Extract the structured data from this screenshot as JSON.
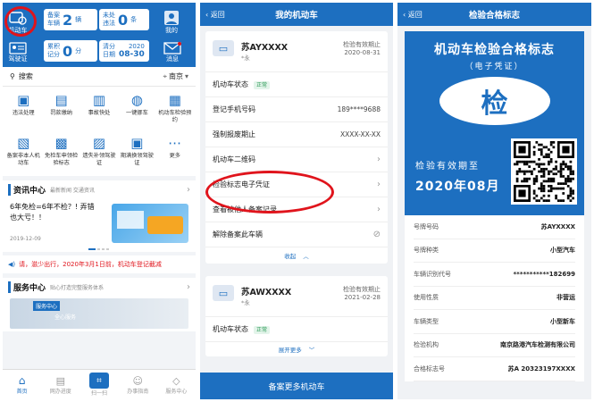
{
  "p1": {
    "tiles": {
      "car": "机动车",
      "license": "驾驶证",
      "mine": "我的",
      "msg": "消息"
    },
    "stats": {
      "pending_l1": "备案",
      "pending_l2": "车辆",
      "pending_n": "2",
      "pending_u": "辆",
      "unhandled_l1": "未处",
      "unhandled_l2": "违法",
      "unhandled_n": "0",
      "unhandled_u": "条",
      "points_l1": "累积",
      "points_l2": "记分",
      "points_n": "0",
      "points_u": "分",
      "clear_l1": "清分",
      "clear_l2": "日期",
      "clear_year": "2020",
      "clear_date": "08-30"
    },
    "search": "搜索",
    "city": "南京",
    "grid": [
      "违法处理",
      "罚款缴纳",
      "事故快处",
      "一键挪车",
      "机动车检验预约",
      "备案非本人机动车",
      "免检车申领检验标志",
      "遗失补领驾驶证",
      "期满换领驾驶证",
      "更多"
    ],
    "news_title": "资讯中心",
    "news_sub": "最新新闻 交通资讯",
    "news_text": "6年免检=6年不检？! 弄错也大亏！！",
    "news_date": "2019-12-09",
    "notice": "请，滋少出行，2020年3月1日前，机动车登记截减",
    "service_title": "服务中心",
    "service_sub": "贴心打造完整服务体系",
    "service_img": "服务中心",
    "service_img2": "全心服务",
    "tabs": [
      "首页",
      "网办进度",
      "扫一扫",
      "办事指南",
      "服务中心"
    ]
  },
  "p2": {
    "back": "返回",
    "title": "我的机动车",
    "car1": {
      "plate": "苏AYXXXX",
      "sub": "*永",
      "exp_label": "检验有效期止",
      "exp": "2020-08-31"
    },
    "rows": [
      {
        "label": "机动车状态",
        "tag": "正常",
        "value": ""
      },
      {
        "label": "登记手机号码",
        "value": "189****9688"
      },
      {
        "label": "强制报废期止",
        "value": "XXXX-XX-XX"
      },
      {
        "label": "机动车二维码",
        "value": ""
      },
      {
        "label": "检验标志电子凭证",
        "value": ""
      },
      {
        "label": "查看被他人备案记录",
        "value": ""
      },
      {
        "label": "解除备案此车辆",
        "value": ""
      }
    ],
    "collapse": "收起",
    "car2": {
      "plate": "苏AWXXXX",
      "sub": "*永",
      "exp_label": "检验有效期止",
      "exp": "2021-02-28"
    },
    "car2_status": "机动车状态",
    "car2_tag": "正常",
    "expand": "展开更多",
    "bottom": "备案更多机动车"
  },
  "p3": {
    "back": "返回",
    "title": "检验合格标志",
    "cert_title": "机动车检验合格标志",
    "cert_sub": "（电子凭证）",
    "seal": "检",
    "valid_label": "检验有效期至",
    "valid_date": "2020年08月",
    "info": [
      {
        "k": "号牌号码",
        "v": "苏AYXXXX"
      },
      {
        "k": "号牌种类",
        "v": "小型汽车"
      },
      {
        "k": "车辆识别代号",
        "v": "***********182699"
      },
      {
        "k": "使用性质",
        "v": "非营运"
      },
      {
        "k": "车辆类型",
        "v": "小型新车"
      },
      {
        "k": "检验机构",
        "v": "南京路港汽车检测有限公司"
      },
      {
        "k": "合格标志号",
        "v": "苏A 20323197XXXX"
      }
    ]
  },
  "colors": {
    "brand": "#1d6fc0",
    "highlight": "#e0141c",
    "ok": "#2d9a58"
  }
}
